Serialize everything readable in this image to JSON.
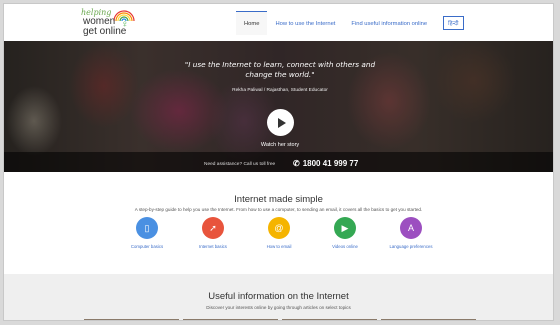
{
  "logo": {
    "line1": "helping",
    "line2": "women",
    "line3": "get online",
    "venus_symbol": "♀"
  },
  "nav": {
    "items": [
      {
        "label": "Home",
        "active": true
      },
      {
        "label": "How to use the Internet",
        "active": false
      },
      {
        "label": "Find useful information online",
        "active": false
      }
    ],
    "language_label": "हिन्दी"
  },
  "hero": {
    "quote": "\"I use the Internet to learn, connect with others and change the world.\"",
    "author": "Rekha Paliwal / Rajasthan, Student Educator",
    "watch_label": "Watch her story",
    "help_text": "Need assistance? Call us toll free",
    "phone": "1800 41 999 77"
  },
  "simple_section": {
    "title": "Internet made simple",
    "description": "A step-by-step guide to help you use the Internet. From how to use a computer, to sending an email, it covers all the basics to get you started.",
    "items": [
      {
        "label": "Computer basics",
        "color": "#4a90e2",
        "icon": "computer-icon"
      },
      {
        "label": "Internet basics",
        "color": "#e8543c",
        "icon": "cursor-icon"
      },
      {
        "label": "How to email",
        "color": "#f5b400",
        "icon": "at-icon"
      },
      {
        "label": "Videos online",
        "color": "#34a853",
        "icon": "video-icon"
      },
      {
        "label": "Language preferences",
        "color": "#9c4fc0",
        "icon": "language-icon"
      }
    ]
  },
  "useful_section": {
    "title": "Useful information on the Internet",
    "description": "Discover your interests online by going through articles on select topics"
  },
  "colors": {
    "link": "#3a6cc8",
    "accent": "#3a6cc8"
  }
}
